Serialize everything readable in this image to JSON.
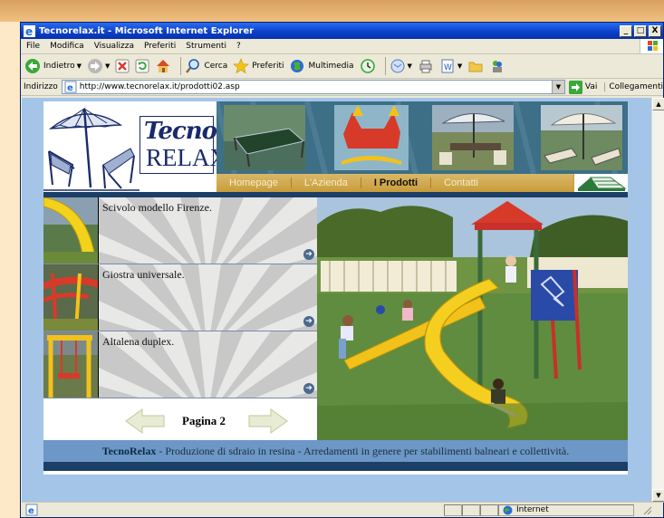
{
  "window": {
    "title": "Tecnorelax.it - Microsoft Internet Explorer",
    "buttons": [
      "_",
      "□",
      "X"
    ]
  },
  "menu": [
    "File",
    "Modifica",
    "Visualizza",
    "Preferiti",
    "Strumenti",
    "?"
  ],
  "toolbar": {
    "back_label": "Indietro",
    "search_label": "Cerca",
    "favorites_label": "Preferiti",
    "media_label": "Multimedia"
  },
  "addressbar": {
    "label": "Indirizzo",
    "url": "http://www.tecnorelax.it/prodotti02.asp",
    "go_label": "Vai",
    "links_label": "Collegamenti"
  },
  "site": {
    "logo": {
      "line1": "Tecno",
      "line2": "RELAX"
    },
    "nav": [
      "Homepage",
      "L'Azienda",
      "I Prodotti",
      "Contatti"
    ],
    "active_nav": "I Prodotti",
    "products": [
      {
        "name": "Scivolo modello Firenze."
      },
      {
        "name": "Giostra universale."
      },
      {
        "name": "Altalena duplex."
      }
    ],
    "pager_label": "Pagina 2",
    "footer": {
      "brand": "TecnoRelax",
      "text": " - Produzione di sdraio in resina - Arredamenti in genere per stabilimenti balneari e collettività."
    }
  },
  "status": {
    "zone": "Internet"
  },
  "colors": {
    "titlebar": "#0a3fc8",
    "nav_gold": "#c99c3a",
    "navy": "#1b3f66",
    "footer_blue": "#6d97c6",
    "viewport_blue": "#a4c5e8"
  }
}
